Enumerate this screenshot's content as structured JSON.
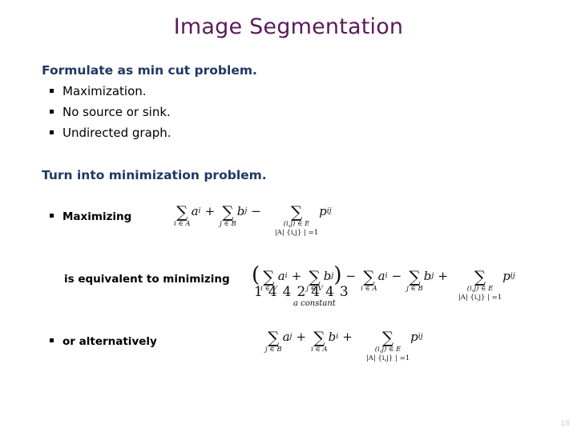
{
  "slide": {
    "title": "Image Segmentation",
    "page_number": "18",
    "colors": {
      "title": "#5B1A5B",
      "heading": "#1F3864",
      "body": "#000000",
      "background": "#FFFFFF",
      "page_number": "#C9C9D2"
    }
  },
  "content": {
    "heading_1": "Formulate as min cut problem.",
    "bullets_1": [
      "Maximization.",
      "No source or sink.",
      "Undirected graph."
    ],
    "heading_2": "Turn into minimization problem.",
    "bullet_maximizing": "Maximizing",
    "label_equivalent": "is equivalent to minimizing",
    "bullet_alternatively": "or alternatively"
  },
  "formulas": {
    "maximizing": {
      "latex": "\\sum_{i \\in A} a_i + \\sum_{j \\in B} b_j - \\sum_{(i,j) \\in E,\\ |A \\cap \\{i,j\\}| = 1} p_{ij}",
      "parts": {
        "sum1_sigma": "∑",
        "sum1_limit": "i ∈ A",
        "sum1_term": "a",
        "sum1_sub": "i",
        "plus": "+",
        "sum2_sigma": "∑",
        "sum2_limit": "j ∈ B",
        "sum2_term": "b",
        "sum2_sub": "j",
        "minus": "−",
        "sum3_sigma": "∑",
        "sum3_limit_a": "(i,j) ∈ E",
        "sum3_limit_b": "|A| {i,j} | =1",
        "sum3_term": "p",
        "sum3_sub": "ij"
      }
    },
    "equivalent": {
      "latex": "\\left( \\sum_{i \\in A} a_i + \\sum_{j \\in V} b_j \\right) - \\sum_{i \\in A} a_i - \\sum_{j \\in B} b_j + \\sum_{(i,j) \\in E,\\ |A \\cap \\{i,j\\}| = 1} p_{ij}",
      "brace_artifact": "1442443",
      "brace_label": "a constant",
      "parts": {
        "lparen": "(",
        "rparen": ")",
        "sum1_sigma": "∑",
        "sum1_limit": "i ∈ V",
        "sum1_term": "a",
        "sum1_sub": "i",
        "plus": "+",
        "sum2_sigma": "∑",
        "sum2_limit": "j ∈ V",
        "sum2_term": "b",
        "sum2_sub": "j",
        "minus1": "−",
        "sum3_sigma": "∑",
        "sum3_limit": "i ∈ A",
        "sum3_term": "a",
        "sum3_sub": "i",
        "minus2": "−",
        "sum4_sigma": "∑",
        "sum4_limit": "j ∈ B",
        "sum4_term": "b",
        "sum4_sub": "j",
        "plus2": "+",
        "sum5_sigma": "∑",
        "sum5_limit_a": "(i,j) ∈ E",
        "sum5_limit_b": "|A| {i,j} | =1",
        "sum5_term": "p",
        "sum5_sub": "ij"
      }
    },
    "alternatively": {
      "latex": "\\sum_{j \\in B} a_j + \\sum_{i \\in A} b_i + \\sum_{(i,j) \\in E,\\ |A \\cap \\{i,j\\}| = 1} p_{ij}",
      "parts": {
        "sum1_sigma": "∑",
        "sum1_limit": "j ∈ B",
        "sum1_term": "a",
        "sum1_sub": "j",
        "plus1": "+",
        "sum2_sigma": "∑",
        "sum2_limit": "i ∈ A",
        "sum2_term": "b",
        "sum2_sub": "i",
        "plus2": "+",
        "sum3_sigma": "∑",
        "sum3_limit_a": "(i,j) ∈ E",
        "sum3_limit_b": "|A| {i,j} | =1",
        "sum3_term": "p",
        "sum3_sub": "ij"
      }
    }
  }
}
